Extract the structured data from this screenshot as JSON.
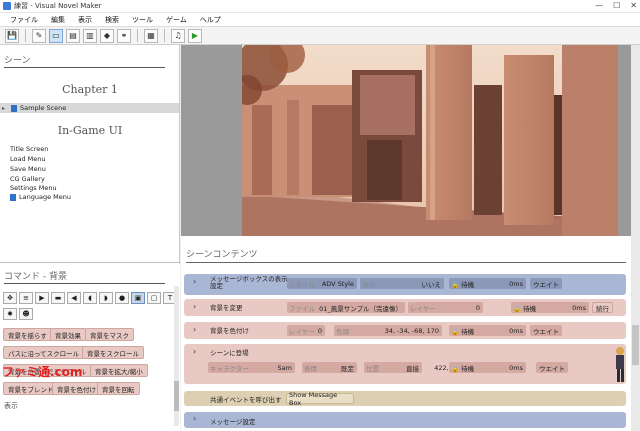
{
  "window": {
    "title": "練習 - Visual Novel Maker",
    "min": "—",
    "max": "☐",
    "close": "✕"
  },
  "menu": [
    "ファイル",
    "編集",
    "表示",
    "検索",
    "ツール",
    "ゲーム",
    "ヘルプ"
  ],
  "toolbar": {
    "icons": [
      "save-icon",
      "pencil-icon",
      "scene-icon",
      "document-icon",
      "copy-icon",
      "tag-icon",
      "link-icon",
      "layers-icon",
      "music-icon",
      "play-icon"
    ],
    "glyphs": [
      "💾",
      "✎",
      "▭",
      "▤",
      "▥",
      "◆",
      "⚭",
      "▦",
      "♫",
      "▶"
    ]
  },
  "scene_panel": {
    "header": "シーン",
    "chapter1": "Chapter 1",
    "scene": "Sample Scene",
    "ingame": "In-Game UI",
    "ui_items": [
      "Title Screen",
      "Load Menu",
      "Save Menu",
      "CG Gallery",
      "Settings Menu",
      "Language Menu"
    ]
  },
  "command_panel": {
    "header": "コマンド - 背景",
    "icon_glyphs": [
      "✥",
      "≡",
      "▶",
      "▬",
      "◀",
      "◖",
      "◗",
      "●",
      "▣",
      "▢",
      "T",
      "▥",
      "✹",
      "☻"
    ],
    "icon_names": [
      "move-icon",
      "list-icon",
      "video-icon",
      "panorama-icon",
      "sound-icon",
      "speaker-left-icon",
      "speaker-right-icon",
      "speech-icon",
      "background-icon",
      "frame-icon",
      "text-icon",
      "grid-icon",
      "sun-icon",
      "face-icon"
    ],
    "buttons": [
      "背景を揺らす",
      "背景効果",
      "背景をマスク",
      "パスに沿ってスクロール",
      "背景をスクロール",
      "背景を位置までスクロール",
      "背景を拡大/縮小",
      "背景をブレンド",
      "背景を色付け",
      "背景を回転"
    ],
    "section": "表示"
  },
  "watermark": "ファミ通.com",
  "contents": {
    "header": "シーンコンテンツ",
    "rows": {
      "msgbox": {
        "label": "メッセージボックスの表示設定",
        "style_k": "スタイル",
        "style_v": "ADV Style",
        "disp_k": "表示",
        "disp_v": "いいえ",
        "wait_k": "🔒 待機",
        "wait_v": "0ms",
        "tag": "ウエイト"
      },
      "bg_change": {
        "label": "背景を変更",
        "file_k": "ファイル",
        "file_v": "01_風景サンプル（完遠像）",
        "layer_k": "レイヤー",
        "layer_v": "0",
        "wait_k": "🔒 待機",
        "wait_v": "0ms",
        "tag": "続行"
      },
      "bg_tint": {
        "label": "背景を色付け",
        "layer_k": "レイヤー",
        "layer_v": "0",
        "color_k": "色調",
        "color_v": "34, -34, -68, 170",
        "wait_k": "🔒 待機",
        "wait_v": "0ms",
        "tag": "ウエイト"
      },
      "enter": {
        "label": "シーンに登場",
        "char_k": "キャラクター",
        "char_v": "Sam",
        "expr_k": "表情",
        "expr_v": "既定",
        "pos_k": "位置",
        "pos_v": "直接",
        "coords": "422, 30",
        "wait_k": "🔒 待機",
        "wait_v": "0ms",
        "tag": "ウエイト"
      },
      "common": {
        "label": "共通イベントを呼び出す",
        "value": "Show Message Box"
      },
      "msgset": {
        "label": "メッセージ設定"
      }
    }
  },
  "colors": {
    "blue_row": "#a9b6d4",
    "pink_row": "#e8c9c3",
    "tan_row": "#ddd0b2",
    "field_blue": "#8b98b8",
    "field_pink": "#d3a9a2"
  }
}
